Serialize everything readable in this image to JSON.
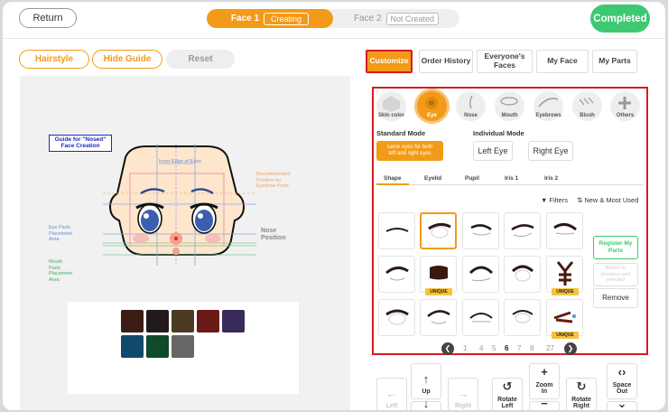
{
  "header": {
    "return_label": "Return",
    "face1": {
      "label": "Face 1",
      "status": "Creating"
    },
    "face2": {
      "label": "Face 2",
      "status": "Not Created"
    },
    "completed_label": "Completed"
  },
  "left_toolbar": {
    "hairstyle_label": "Hairstyle",
    "hide_guide_label": "Hide Guide",
    "reset_label": "Reset"
  },
  "guide": {
    "title_line1": "Guide for \"Nosed\"",
    "title_line2": "Face Creation",
    "inner_edge": "Inner Edge of Eyes",
    "recommended_1": "Recommended",
    "recommended_2": "Position for",
    "recommended_3": "Eyebrow Parts",
    "eye_area_1": "Eye Parts",
    "eye_area_2": "Placement",
    "eye_area_3": "Area",
    "nose_1": "Nose",
    "nose_2": "Position",
    "mouth_1": "Mouth",
    "mouth_2": "Parts",
    "mouth_3": "Placement",
    "mouth_4": "Area"
  },
  "palette": {
    "colors": [
      "#3b1d15",
      "#231b1b",
      "#4a3b22",
      "#6a1a17",
      "#3a2a5a",
      "#0f4a6a",
      "#0f4a2a",
      "#666666"
    ]
  },
  "right_tabs": [
    {
      "label": "Customize",
      "active": true
    },
    {
      "label": "Order History"
    },
    {
      "label": "Everyone's Faces"
    },
    {
      "label": "My Face"
    },
    {
      "label": "My Parts"
    }
  ],
  "categories": [
    {
      "label": "Skin color",
      "icon": "skin-icon"
    },
    {
      "label": "Eye",
      "icon": "eye-icon",
      "active": true
    },
    {
      "label": "Nose",
      "icon": "nose-icon"
    },
    {
      "label": "Mouth",
      "icon": "mouth-icon"
    },
    {
      "label": "Eyebrows",
      "icon": "eyebrows-icon"
    },
    {
      "label": "Blush",
      "icon": "blush-icon"
    },
    {
      "label": "Others",
      "icon": "plus-icon"
    }
  ],
  "modes": {
    "standard_title": "Standard Mode",
    "standard_btn_1": "same eyes for both",
    "standard_btn_2": "left and right eyes",
    "individual_title": "Individual Mode",
    "left_eye": "Left Eye",
    "right_eye": "Right Eye"
  },
  "subtabs": [
    "Shape",
    "Eyelid",
    "Pupil",
    "Iris 1",
    "Iris 2"
  ],
  "filters": {
    "filters_label": "Filters",
    "sort_label": "New & Most Used"
  },
  "unique_label": "UNIQUE",
  "side_buttons": {
    "register_1": "Register My",
    "register_2": "Parts",
    "return_1": "Return to",
    "return_2": "previous part",
    "return_3": "selected",
    "remove": "Remove"
  },
  "pagination": {
    "pages": [
      "1",
      "4",
      "5",
      "6",
      "7",
      "8",
      "27"
    ],
    "current": "6"
  },
  "controls": {
    "left": "Left",
    "up": "Up",
    "right": "Right",
    "rotate_left_1": "Rotate",
    "rotate_left_2": "Left",
    "zoom_in_1": "Zoom",
    "zoom_in_2": "In",
    "rotate_right_1": "Rotate",
    "rotate_right_2": "Right",
    "space_out_1": "Space",
    "space_out_2": "Out"
  }
}
